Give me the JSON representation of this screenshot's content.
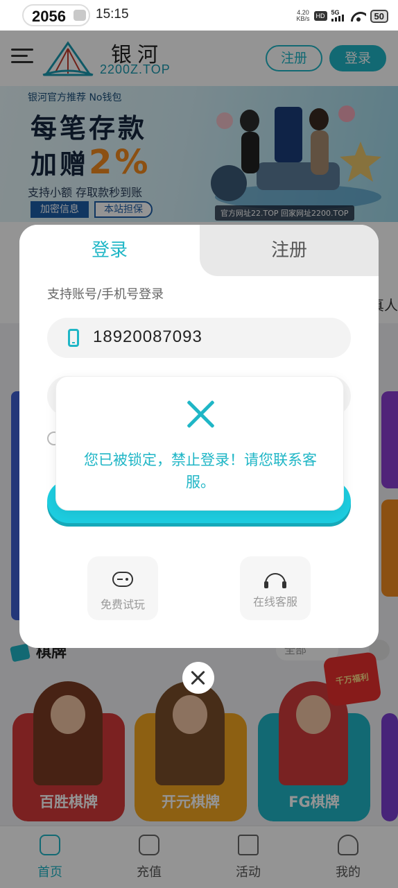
{
  "status_bar": {
    "pill_number": "2056",
    "time": "15:15",
    "net_speed_value": "4.20",
    "net_speed_unit": "KB/s",
    "hd_label": "HD",
    "network_label": "5G",
    "battery": "50"
  },
  "header": {
    "logo_name": "银河",
    "logo_domain": "2200Z.TOP",
    "register_label": "注册",
    "login_label": "登录"
  },
  "banner": {
    "tag": "银河官方推荐  No钱包",
    "headline_1": "每笔存款",
    "headline_2_prefix": "加赠",
    "headline_2_highlight": "2%",
    "subtitle": "支持小额 存取款秒到账",
    "button_1": "加密信息",
    "button_2": "本站担保",
    "footer": "官方网址22.TOP  回家网址2200.TOP"
  },
  "background": {
    "category_right_label": "真人",
    "section_title": "棋牌",
    "filter_label": "全部",
    "promo_badge": "千万福利",
    "games": [
      "百胜棋牌",
      "开元棋牌",
      "FG棋牌"
    ]
  },
  "tabbar": {
    "items": [
      "首页",
      "充值",
      "活动",
      "我的"
    ]
  },
  "modal": {
    "tab_login": "登录",
    "tab_register": "注册",
    "hint": "支持账号/手机号登录",
    "phone_value": "18920087093",
    "forgot_mark": "?",
    "quick_trial": "免费试玩",
    "quick_service": "在线客服"
  },
  "toast": {
    "message": "您已被锁定，禁止登录！请您联系客服。"
  },
  "colors": {
    "accent": "#1fb6c6",
    "submit": "#1dcde0",
    "overlay": "rgba(0,0,0,0.42)"
  }
}
